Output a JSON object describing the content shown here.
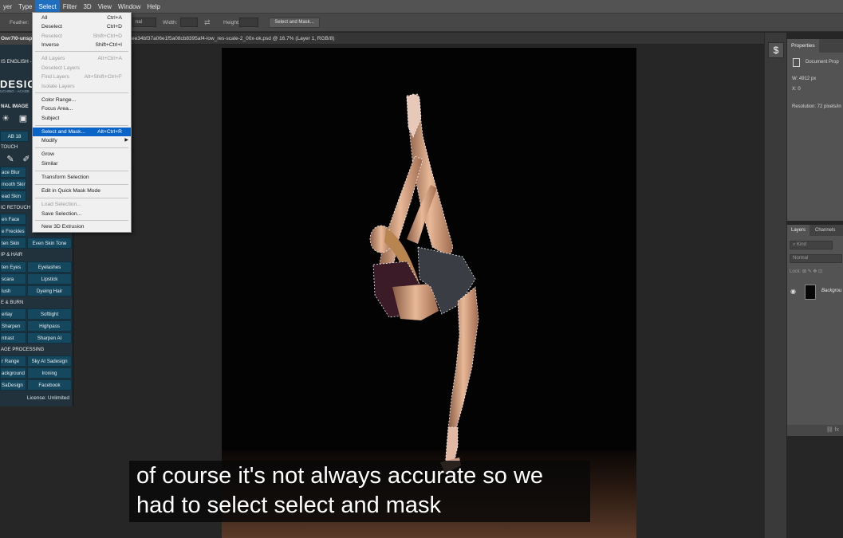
{
  "menubar": {
    "items": [
      "yer",
      "Type",
      "Select",
      "Filter",
      "3D",
      "View",
      "Window",
      "Help"
    ],
    "active": "Select"
  },
  "options_bar": {
    "feather_label": "Feather:",
    "style_value": "nal",
    "width_label": "Width:",
    "height_label": "Height:",
    "select_mask_button": "Select and Mask..."
  },
  "document": {
    "tab_left": "Owr7l0-unsp",
    "tab_title": "ee34bf37a06e1f5a08cb8395af4-low_res-scale-2_00x-ok.psd @ 16.7% (Layer 1, RGB/8)"
  },
  "select_menu": {
    "items": [
      {
        "label": "All",
        "shortcut": "Ctrl+A",
        "disabled": false
      },
      {
        "label": "Deselect",
        "shortcut": "Ctrl+D",
        "disabled": false
      },
      {
        "label": "Reselect",
        "shortcut": "Shift+Ctrl+D",
        "disabled": true
      },
      {
        "label": "Inverse",
        "shortcut": "Shift+Ctrl+I",
        "disabled": false
      },
      {
        "label": "All Layers",
        "shortcut": "Alt+Ctrl+A",
        "disabled": true
      },
      {
        "label": "Deselect Layers",
        "shortcut": "",
        "disabled": true
      },
      {
        "label": "Find Layers",
        "shortcut": "Alt+Shift+Ctrl+F",
        "disabled": true
      },
      {
        "label": "Isolate Layers",
        "shortcut": "",
        "disabled": true
      },
      {
        "label": "Color Range...",
        "shortcut": "",
        "disabled": false
      },
      {
        "label": "Focus Area...",
        "shortcut": "",
        "disabled": false
      },
      {
        "label": "Subject",
        "shortcut": "",
        "disabled": false
      },
      {
        "label": "Select and Mask...",
        "shortcut": "Alt+Ctrl+R",
        "disabled": false,
        "highlighted": true
      },
      {
        "label": "Modify",
        "shortcut": "",
        "disabled": false,
        "submenu": true
      },
      {
        "label": "Grow",
        "shortcut": "",
        "disabled": false
      },
      {
        "label": "Similar",
        "shortcut": "",
        "disabled": false
      },
      {
        "label": "Transform Selection",
        "shortcut": "",
        "disabled": false
      },
      {
        "label": "Edit in Quick Mask Mode",
        "shortcut": "",
        "disabled": false
      },
      {
        "label": "Load Selection...",
        "shortcut": "",
        "disabled": true
      },
      {
        "label": "Save Selection...",
        "shortcut": "",
        "disabled": false
      },
      {
        "label": "New 3D Extrusion",
        "shortcut": "",
        "disabled": false
      }
    ]
  },
  "plugin": {
    "header": "IS ENGLISH -",
    "brand": "DESIG",
    "brand_sub": "UCHING - ACADE",
    "section_original": "NAL IMAGE",
    "tab": "AB 18",
    "section_touch": "TOUCH",
    "buttons_a": [
      "ace Blur",
      "mooth Skin",
      "ead Skin"
    ],
    "section_basic": "IC RETOUCH",
    "buttons_b": [
      "en Face",
      "e Freckles"
    ],
    "row_skin": [
      "ten Skin",
      "Even Skin Tone"
    ],
    "section_makeup": "IP & HAIR",
    "row_eyes": [
      "ten Eyes",
      "Eyelashes"
    ],
    "row_lip": [
      "scara",
      "Lipstick"
    ],
    "row_hair": [
      "lush",
      "Dyeing Hair"
    ],
    "section_dodge": "E & BURN",
    "row_light": [
      "erlay",
      "Softlight"
    ],
    "row_sharp": [
      "Sharpen",
      "Highpass"
    ],
    "row_contrast": [
      "ntrast",
      "Sharpen AI"
    ],
    "section_processing": "AGE PROCESSING",
    "row_sky": [
      "r Range",
      "Sky AI Sadesign"
    ],
    "row_bg": [
      "ackground",
      "Ironing"
    ],
    "row_social": [
      "SaDesign",
      "Facebook"
    ],
    "license": "License: Unlimited"
  },
  "properties": {
    "tab": "Properties",
    "doc_label": "Document Prop",
    "w_label": "W:",
    "w_value": "4912 px",
    "x_label": "X:",
    "x_value": "0",
    "resolution": "Resolution: 72 pixels/in"
  },
  "layers": {
    "tab_layers": "Layers",
    "tab_channels": "Channels",
    "kind_placeholder": "Kind",
    "blend_mode": "Normal",
    "lock_label": "Lock:",
    "layer_name": "Backgrou"
  },
  "caption": {
    "line1": "of course it's not always accurate so we",
    "line2": "had to select select and mask"
  },
  "colors": {
    "menu_highlight": "#0a64c8",
    "plugin_button": "#15485e",
    "canvas_bg": "#030303"
  }
}
